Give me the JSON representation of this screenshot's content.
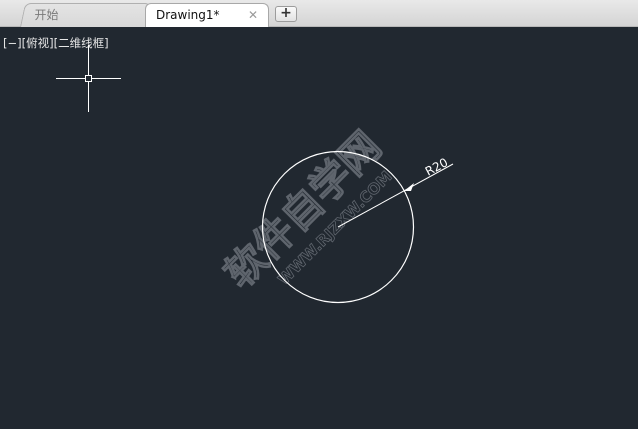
{
  "tabs": [
    {
      "label": "开始",
      "active": false
    },
    {
      "label": "Drawing1*",
      "active": true,
      "close_glyph": "✕"
    }
  ],
  "add_tab_glyph": "+",
  "viewport": {
    "controls": [
      "[−]",
      "[俯视]",
      "[二维线框]"
    ]
  },
  "drawing": {
    "dimension_text": "R20",
    "watermark_line1": "软件自学网",
    "watermark_line2": "WWW.RJZXW.COM"
  },
  "colors": {
    "canvas_background": "#212830",
    "geometry": "#ffffff",
    "watermark": "#aab0b8"
  },
  "icons": [
    "crosshair-cursor-icon",
    "close-icon",
    "plus-icon"
  ]
}
